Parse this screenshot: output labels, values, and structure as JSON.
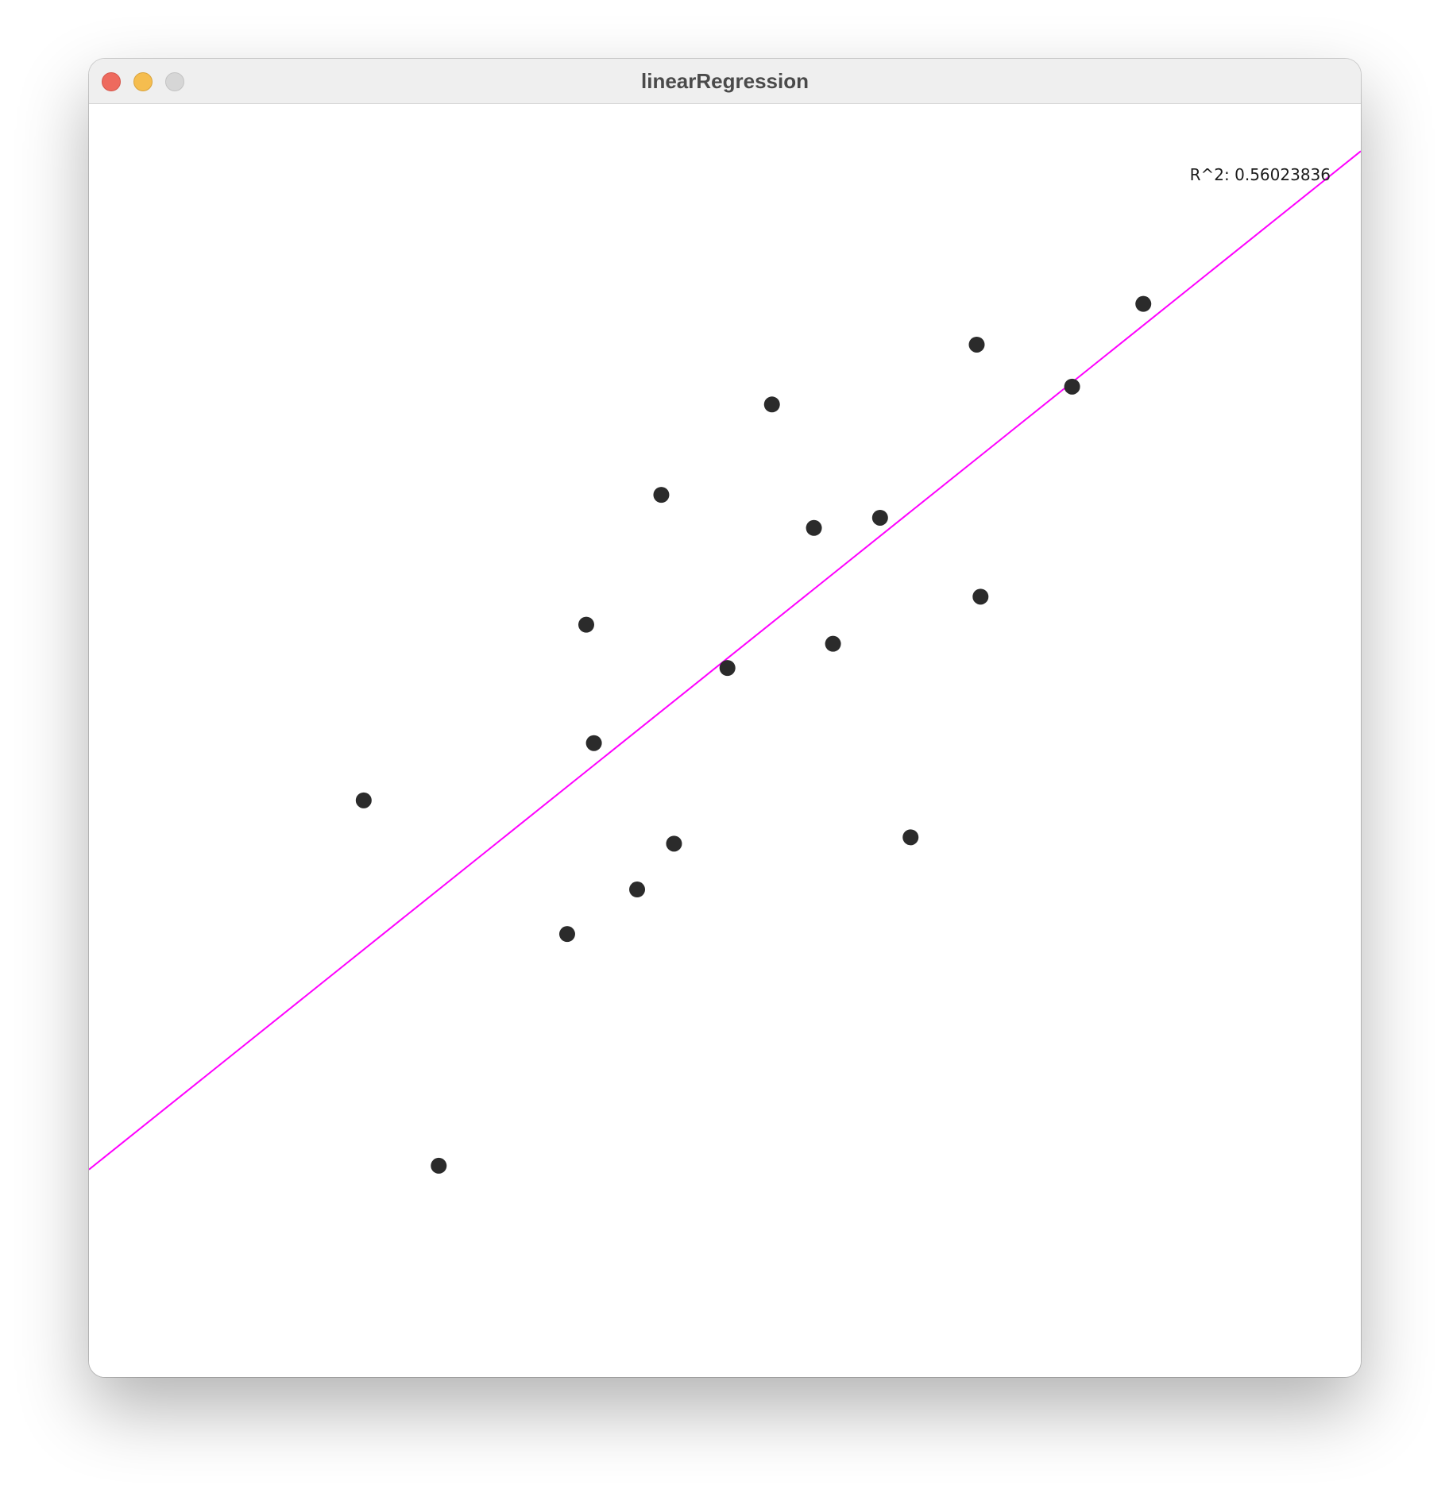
{
  "window": {
    "title": "linearRegression",
    "controls": [
      "close",
      "minimize",
      "zoom"
    ]
  },
  "colors": {
    "regression_line": "#ff00ff",
    "points": "#2b2b2b",
    "background": "#ffffff"
  },
  "r_squared_label": "R^2: 0.56023836",
  "chart_data": {
    "type": "scatter",
    "x_range": [
      0,
      1
    ],
    "y_range": [
      0,
      1
    ],
    "points": [
      {
        "x": 0.216,
        "y": 0.453
      },
      {
        "x": 0.275,
        "y": 0.166
      },
      {
        "x": 0.376,
        "y": 0.348
      },
      {
        "x": 0.391,
        "y": 0.591
      },
      {
        "x": 0.397,
        "y": 0.498
      },
      {
        "x": 0.431,
        "y": 0.383
      },
      {
        "x": 0.45,
        "y": 0.693
      },
      {
        "x": 0.46,
        "y": 0.419
      },
      {
        "x": 0.502,
        "y": 0.557
      },
      {
        "x": 0.537,
        "y": 0.764
      },
      {
        "x": 0.57,
        "y": 0.667
      },
      {
        "x": 0.585,
        "y": 0.576
      },
      {
        "x": 0.622,
        "y": 0.675
      },
      {
        "x": 0.646,
        "y": 0.424
      },
      {
        "x": 0.698,
        "y": 0.811
      },
      {
        "x": 0.701,
        "y": 0.613
      },
      {
        "x": 0.773,
        "y": 0.778
      },
      {
        "x": 0.829,
        "y": 0.843
      }
    ],
    "regression": {
      "slope": 0.8,
      "intercept": 0.163
    }
  }
}
